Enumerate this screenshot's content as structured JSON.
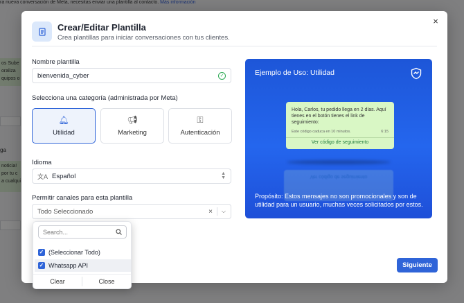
{
  "background": {
    "top_text": "ra nueva conversación de Meta, necesitas enviar una plantilla al contacto.",
    "top_link": "Más información",
    "snip1": "os Sube",
    "snip2": "oraliza",
    "snip3": "quipos o a",
    "snip4": "ga",
    "snip5": "noticia!",
    "snip6": "por tu c",
    "snip7": "a cualqui"
  },
  "modal": {
    "title": "Crear/Editar Plantilla",
    "subtitle": "Crea plantillas para iniciar conversaciones con tus clientes.",
    "close_label": "×",
    "name_label": "Nombre plantilla",
    "name_value": "bienvenida_cyber",
    "category_label": "Selecciona una categoría (administrada por Meta)",
    "categories": [
      {
        "label": "Utilidad",
        "icon": "bell-icon",
        "glyph": "🔔︎",
        "active": true
      },
      {
        "label": "Marketing",
        "icon": "megaphone-icon",
        "glyph": "📢︎",
        "active": false
      },
      {
        "label": "Autenticación",
        "icon": "key-icon",
        "glyph": "⚿",
        "active": false
      }
    ],
    "language_label": "Idioma",
    "language_value": "Español",
    "channels_label": "Permitir canales para esta plantilla",
    "channels_value": "Todo Seleccionado",
    "next_button": "Siguiente"
  },
  "preview": {
    "title": "Ejemplo de Uso: Utilidad",
    "message": "Hola, Carlos, tu pedido llega en 2 días. Aquí tienes en el botón tienes el link de seguimiento:",
    "footer": "Este código caduca en 10 minutos.",
    "time": "6:15",
    "button": "Ver código de seguimiento",
    "reflection_text": "Ver código de seguimiento",
    "purpose": "Propósito: Estos mensajes no son promocionales y son de utilidad para un usuario, muchas veces solicitados por estos."
  },
  "dropdown": {
    "search_placeholder": "Search...",
    "options": [
      {
        "label": "(Seleccionar Todo)",
        "checked": true
      },
      {
        "label": "Whatsapp API",
        "checked": true
      }
    ],
    "clear_label": "Clear",
    "close_label": "Close"
  },
  "colors": {
    "accent": "#2f64d8",
    "preview_bg": "#2466ee",
    "bubble": "#d9f7c5",
    "success": "#2eaa55"
  }
}
